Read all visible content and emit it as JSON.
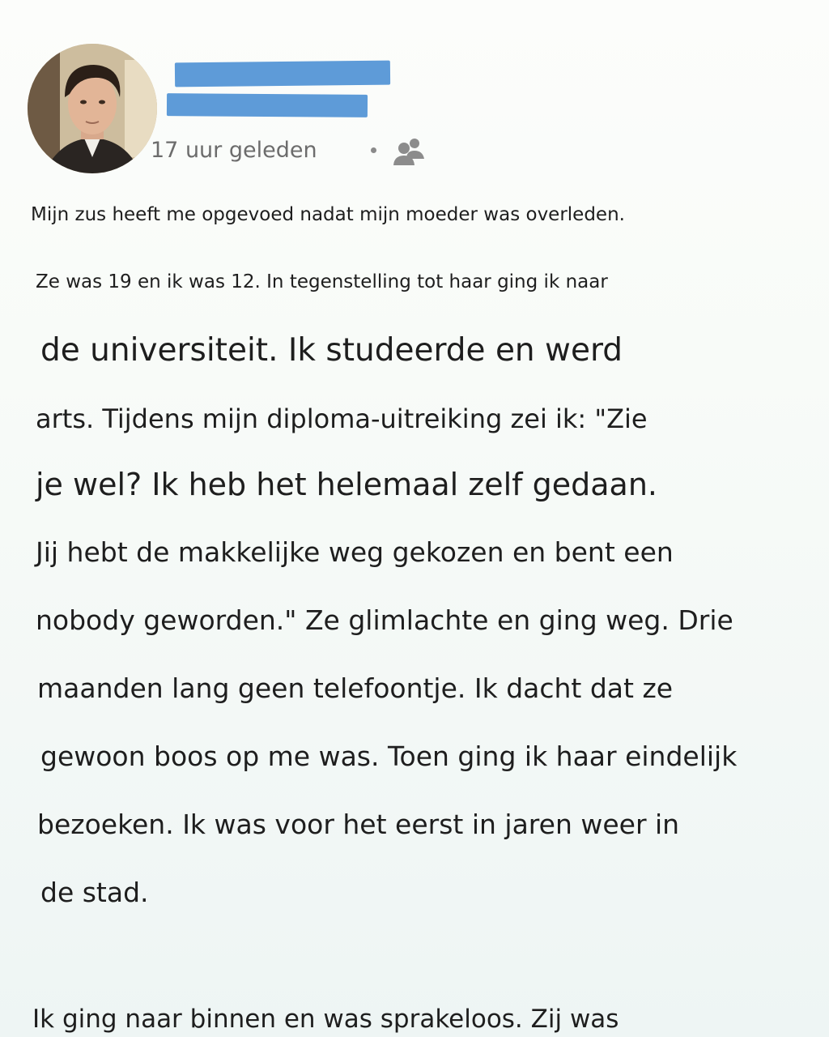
{
  "author": {
    "name_redacted": true,
    "timestamp": "17 uur geleden",
    "audience_icon": "friends-icon"
  },
  "post": {
    "lines": [
      "Mijn zus heeft me opgevoed nadat mijn moeder was overleden.",
      "Ze was 19 en ik was 12. In tegenstelling tot haar ging ik naar",
      "de universiteit. Ik studeerde en werd",
      "arts. Tijdens mijn diploma-uitreiking zei ik: \"Zie",
      "je wel? Ik heb het helemaal zelf gedaan.",
      "Jij hebt de makkelijke weg gekozen en bent een",
      "nobody geworden.\" Ze glimlachte en ging weg. Drie",
      "maanden lang geen telefoontje. Ik dacht dat ze",
      "gewoon boos op me was. Toen ging ik haar eindelijk",
      "bezoeken. Ik was voor het eerst in jaren weer in",
      "de stad.",
      "Ik ging naar binnen en was sprakeloos. Zij was"
    ]
  },
  "colors": {
    "redaction": "#5e9bd8",
    "meta_text": "#6c6c6c"
  }
}
